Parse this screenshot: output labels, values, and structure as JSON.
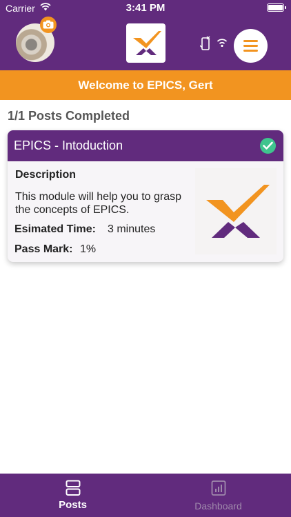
{
  "status_bar": {
    "carrier": "Carrier",
    "time": "3:41 PM"
  },
  "header": {
    "avatar_alt": "profile photo"
  },
  "welcome": {
    "text": "Welcome to EPICS, Gert"
  },
  "progress": {
    "text": "1/1 Posts Completed"
  },
  "module": {
    "title": "EPICS - Intoduction",
    "description_label": "Description",
    "description": "This module will help you to grasp the concepts of EPICS.",
    "time_label": "Esimated Time:",
    "time_value": "3 minutes",
    "pass_label": "Pass Mark:",
    "pass_value": "1%",
    "completed": true
  },
  "tabs": [
    {
      "label": "Posts",
      "active": true,
      "icon": "posts-icon"
    },
    {
      "label": "Dashboard",
      "active": false,
      "icon": "dashboard-icon"
    }
  ],
  "colors": {
    "purple": "#612b7d",
    "orange": "#f29420",
    "check_green": "#3fc48e"
  }
}
